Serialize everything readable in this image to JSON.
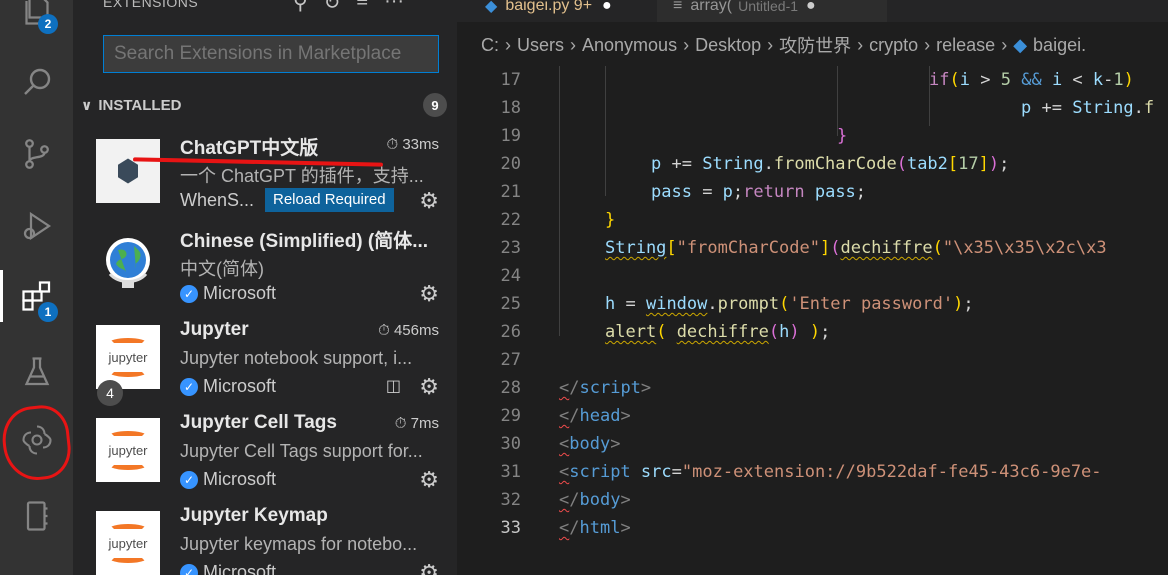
{
  "activity_bar": {
    "explorer_badge": "2",
    "extensions_badge": "1"
  },
  "sidebar": {
    "title": "EXTENSIONS",
    "search_placeholder": "Search Extensions in Marketplace",
    "section_label": "INSTALLED",
    "section_count": "9",
    "extensions": [
      {
        "name": "ChatGPT中文版",
        "time": "33ms",
        "description": "一个 ChatGPT 的插件，支持...",
        "publisher": "WhenS...",
        "reload_label": "Reload Required"
      },
      {
        "name": "Chinese (Simplified) (简体...",
        "time": "",
        "description": "中文(简体)",
        "publisher": "Microsoft"
      },
      {
        "name": "Jupyter",
        "time": "456ms",
        "description": "Jupyter notebook support, i...",
        "publisher": "Microsoft",
        "count_badge": "4"
      },
      {
        "name": "Jupyter Cell Tags",
        "time": "7ms",
        "description": "Jupyter Cell Tags support for...",
        "publisher": "Microsoft"
      },
      {
        "name": "Jupyter Keymap",
        "time": "",
        "description": "Jupyter keymaps for notebo...",
        "publisher": "Microsoft"
      }
    ],
    "jupyter_icon_text": "jupyter"
  },
  "editor": {
    "tabs": [
      {
        "label": "baigei.py 9+"
      },
      {
        "label": "array(",
        "suffix": "Untitled-1"
      }
    ],
    "breadcrumb": [
      "C:",
      "Users",
      "Anonymous",
      "Desktop",
      "攻防世界",
      "crypto",
      "release",
      "baigei."
    ],
    "line_numbers": [
      "17",
      "18",
      "19",
      "20",
      "21",
      "22",
      "23",
      "24",
      "25",
      "26",
      "27",
      "28",
      "29",
      "30",
      "31",
      "32",
      "33"
    ]
  }
}
